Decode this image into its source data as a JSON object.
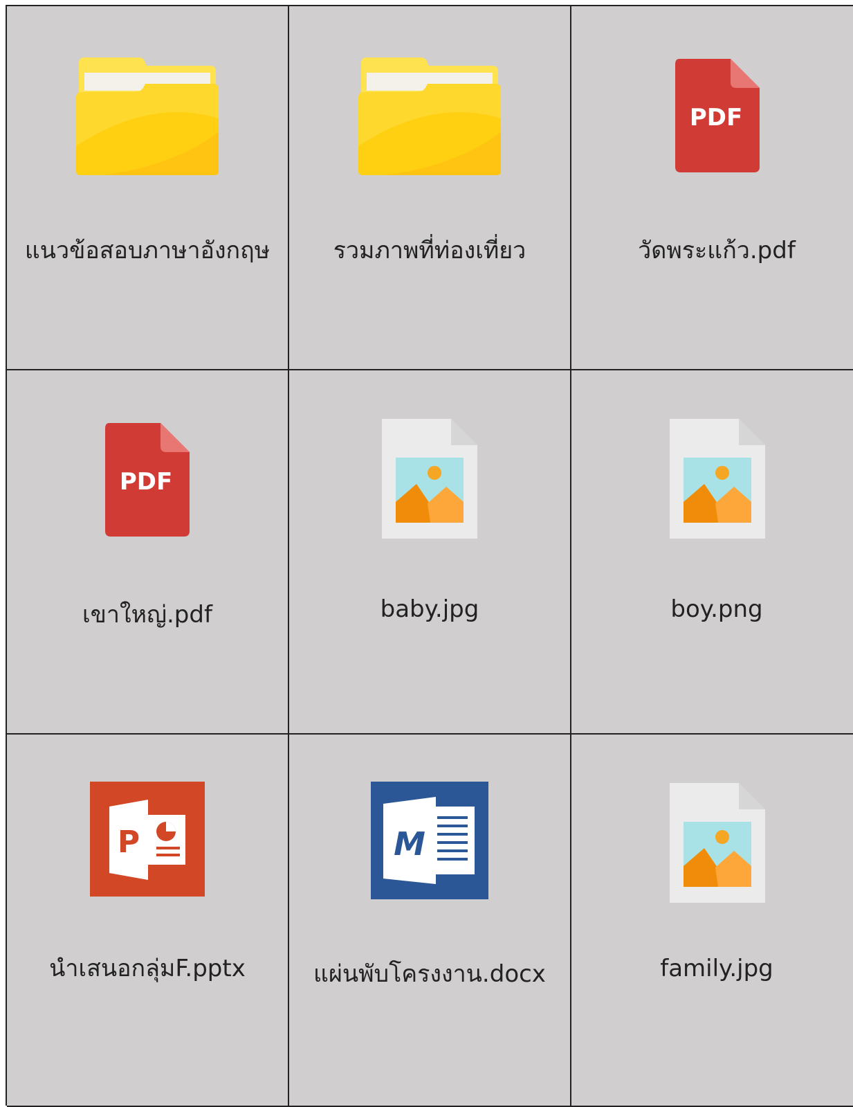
{
  "files": [
    {
      "name": "แนวข้อสอบภาษาอังกฤษ",
      "type": "folder",
      "icon": "folder-icon"
    },
    {
      "name": "รวมภาพที่ท่องเที่ยว",
      "type": "folder",
      "icon": "folder-icon"
    },
    {
      "name": "วัดพระแก้ว.pdf",
      "type": "pdf",
      "icon": "pdf-icon",
      "badge": "PDF"
    },
    {
      "name": "เขาใหญ่.pdf",
      "type": "pdf",
      "icon": "pdf-icon",
      "badge": "PDF"
    },
    {
      "name": "baby.jpg",
      "type": "image",
      "icon": "image-file-icon"
    },
    {
      "name": "boy.png",
      "type": "image",
      "icon": "image-file-icon"
    },
    {
      "name": "นำเสนอกลุ่มF.pptx",
      "type": "pptx",
      "icon": "powerpoint-icon",
      "badge": "P"
    },
    {
      "name": "แผ่นพับโครงงาน.docx",
      "type": "docx",
      "icon": "word-icon",
      "badge": "M"
    },
    {
      "name": "family.jpg",
      "type": "image",
      "icon": "image-file-icon"
    }
  ],
  "colors": {
    "cell_background": "#d0cecf",
    "grid_lines": "#222222",
    "folder": "#ffd012",
    "pdf": "#d13b35",
    "powerpoint": "#d24726",
    "word": "#2b5797",
    "image_sky": "#a8e2e6",
    "image_mountain": "#f08c0a"
  }
}
